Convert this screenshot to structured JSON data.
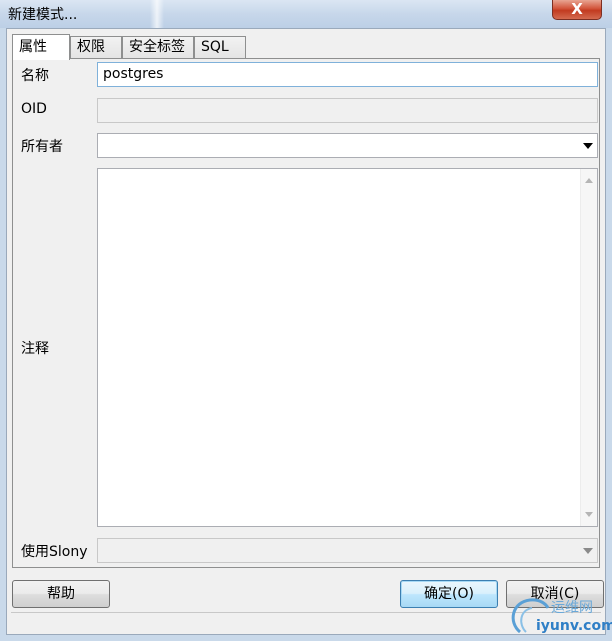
{
  "window": {
    "title": "新建模式...",
    "close_label": "X"
  },
  "tabs": [
    {
      "label": "属性",
      "active": true
    },
    {
      "label": "权限",
      "active": false
    },
    {
      "label": "安全标签",
      "active": false
    },
    {
      "label": "SQL",
      "active": false
    }
  ],
  "form": {
    "name_label": "名称",
    "name_value": "postgres",
    "oid_label": "OID",
    "oid_value": "",
    "owner_label": "所有者",
    "owner_value": "",
    "comment_label": "注释",
    "comment_value": "",
    "slony_label": "使用Slony",
    "slony_value": ""
  },
  "buttons": {
    "help": "帮助",
    "ok": "确定(O)",
    "cancel": "取消(C)"
  },
  "watermark": {
    "text_cn": "运维网",
    "text_url": "iyunv.com"
  },
  "colors": {
    "title_bar": "#c7d7ea",
    "close_red": "#c23b20",
    "default_button": "#a7d9f5",
    "focus_border": "#7fb1da"
  }
}
